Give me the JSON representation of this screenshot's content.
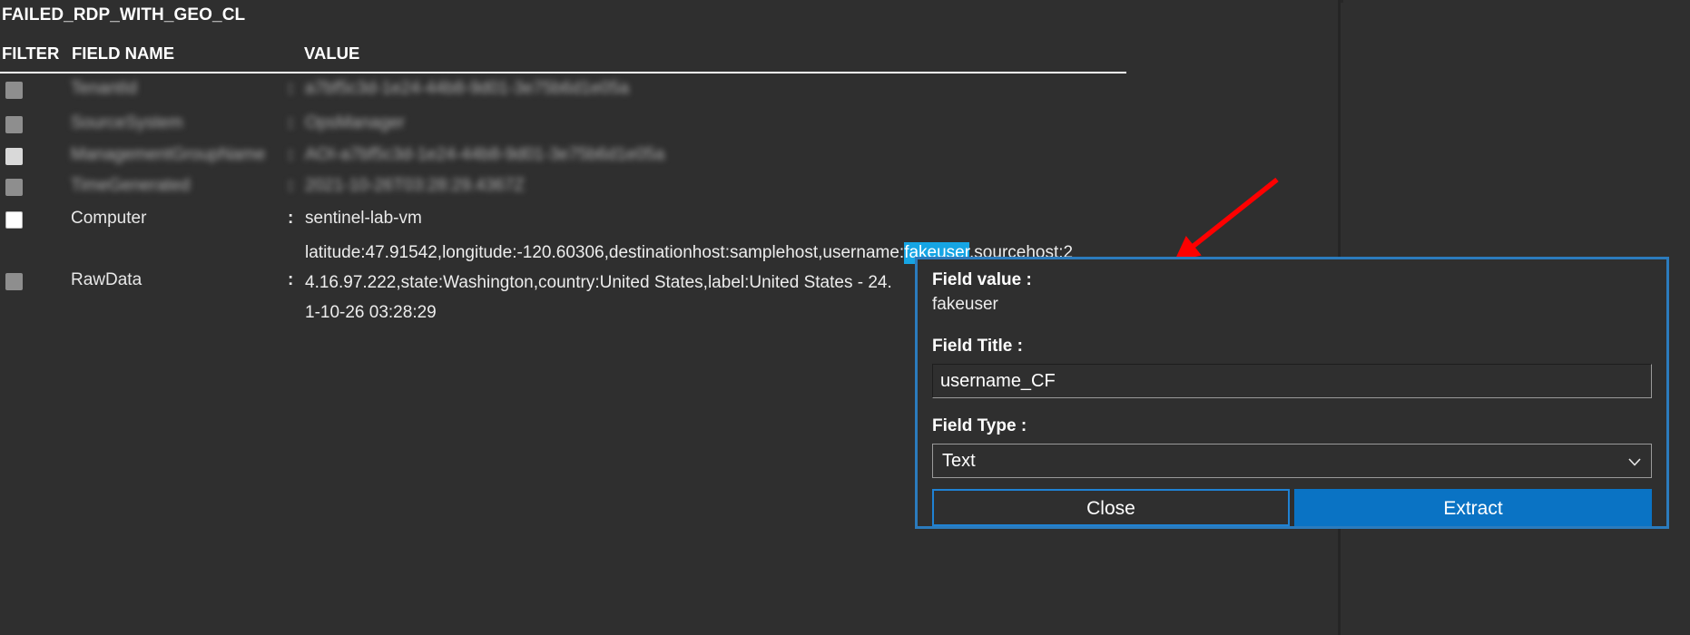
{
  "panel": {
    "title": "FAILED_RDP_WITH_GEO_CL",
    "columns": {
      "filter": "FILTER",
      "field_name": "FIELD NAME",
      "value": "VALUE"
    },
    "rows": [
      {
        "checkbox": "dim",
        "redacted": true,
        "field": "TenantId",
        "separator": ":",
        "value": "a7bf5c3d-1e24-44b8-9d01-3e75b6d1e05a"
      },
      {
        "checkbox": "dim",
        "redacted": true,
        "field": "SourceSystem",
        "separator": ":",
        "value": "OpsManager"
      },
      {
        "checkbox": "bright",
        "redacted": true,
        "field": "ManagementGroupName",
        "separator": ":",
        "value": "AOI-a7bf5c3d-1e24-44b8-9d01-3e75b6d1e05a"
      },
      {
        "checkbox": "dim",
        "redacted": true,
        "field": "TimeGenerated",
        "separator": ":",
        "value": "2021-10-26T03:28:29.4367Z"
      },
      {
        "checkbox": "on",
        "redacted": false,
        "field": "Computer",
        "separator": ":",
        "value": "sentinel-lab-vm"
      },
      {
        "checkbox": "dim",
        "redacted": false,
        "field": "RawData",
        "separator": ":",
        "value": ""
      }
    ],
    "rawdata": {
      "line1_before": "latitude:47.91542,longitude:-120.60306,destinationhost:samplehost,username:",
      "line1_highlight": "fakeuser",
      "line1_after": ",sourcehost:2",
      "line2": "4.16.97.222,state:Washington,country:United States,label:United States - 24.",
      "line3": "1-10-26 03:28:29"
    }
  },
  "popup": {
    "field_value_label": "Field value :",
    "field_value": "fakeuser",
    "field_title_label": "Field Title :",
    "field_title_value": "username_CF",
    "field_title_placeholder": "Field Title",
    "field_type_label": "Field Type :",
    "field_type_value": "Text",
    "field_type_options": [
      "Text"
    ],
    "close_label": "Close",
    "extract_label": "Extract",
    "chevron_icon": "chevron-down-icon",
    "border_color": "#2b7bbd",
    "extract_color": "#0a73c4"
  },
  "annotation": {
    "arrow_icon": "red-arrow-icon",
    "arrow_color": "#ff0000",
    "highlight_color": "#16a5e4"
  }
}
